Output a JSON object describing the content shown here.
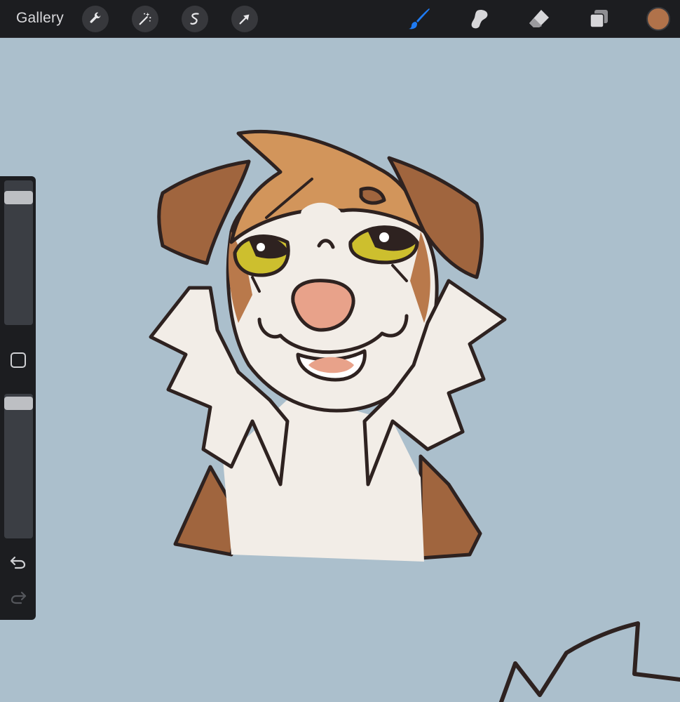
{
  "toolbar": {
    "gallery_label": "Gallery",
    "left_tools": [
      {
        "name": "actions",
        "icon": "wrench-icon"
      },
      {
        "name": "adjustments",
        "icon": "magic-wand-icon"
      },
      {
        "name": "selection",
        "icon": "selection-s-icon"
      },
      {
        "name": "transform",
        "icon": "arrow-icon"
      }
    ],
    "right_tools": [
      {
        "name": "brush",
        "icon": "brush-icon",
        "active": true,
        "color": "#1f7bf2"
      },
      {
        "name": "smudge",
        "icon": "smudge-icon"
      },
      {
        "name": "eraser",
        "icon": "eraser-icon"
      },
      {
        "name": "layers",
        "icon": "layers-icon"
      }
    ],
    "current_color": "#b0724a"
  },
  "sidebar": {
    "brush_size": 0.92,
    "brush_opacity": 0.98,
    "modify_button_icon": "square-icon",
    "undo_icon": "undo-icon",
    "redo_icon": "redo-icon",
    "redo_enabled": false
  },
  "canvas": {
    "background": "#abbfcc"
  }
}
